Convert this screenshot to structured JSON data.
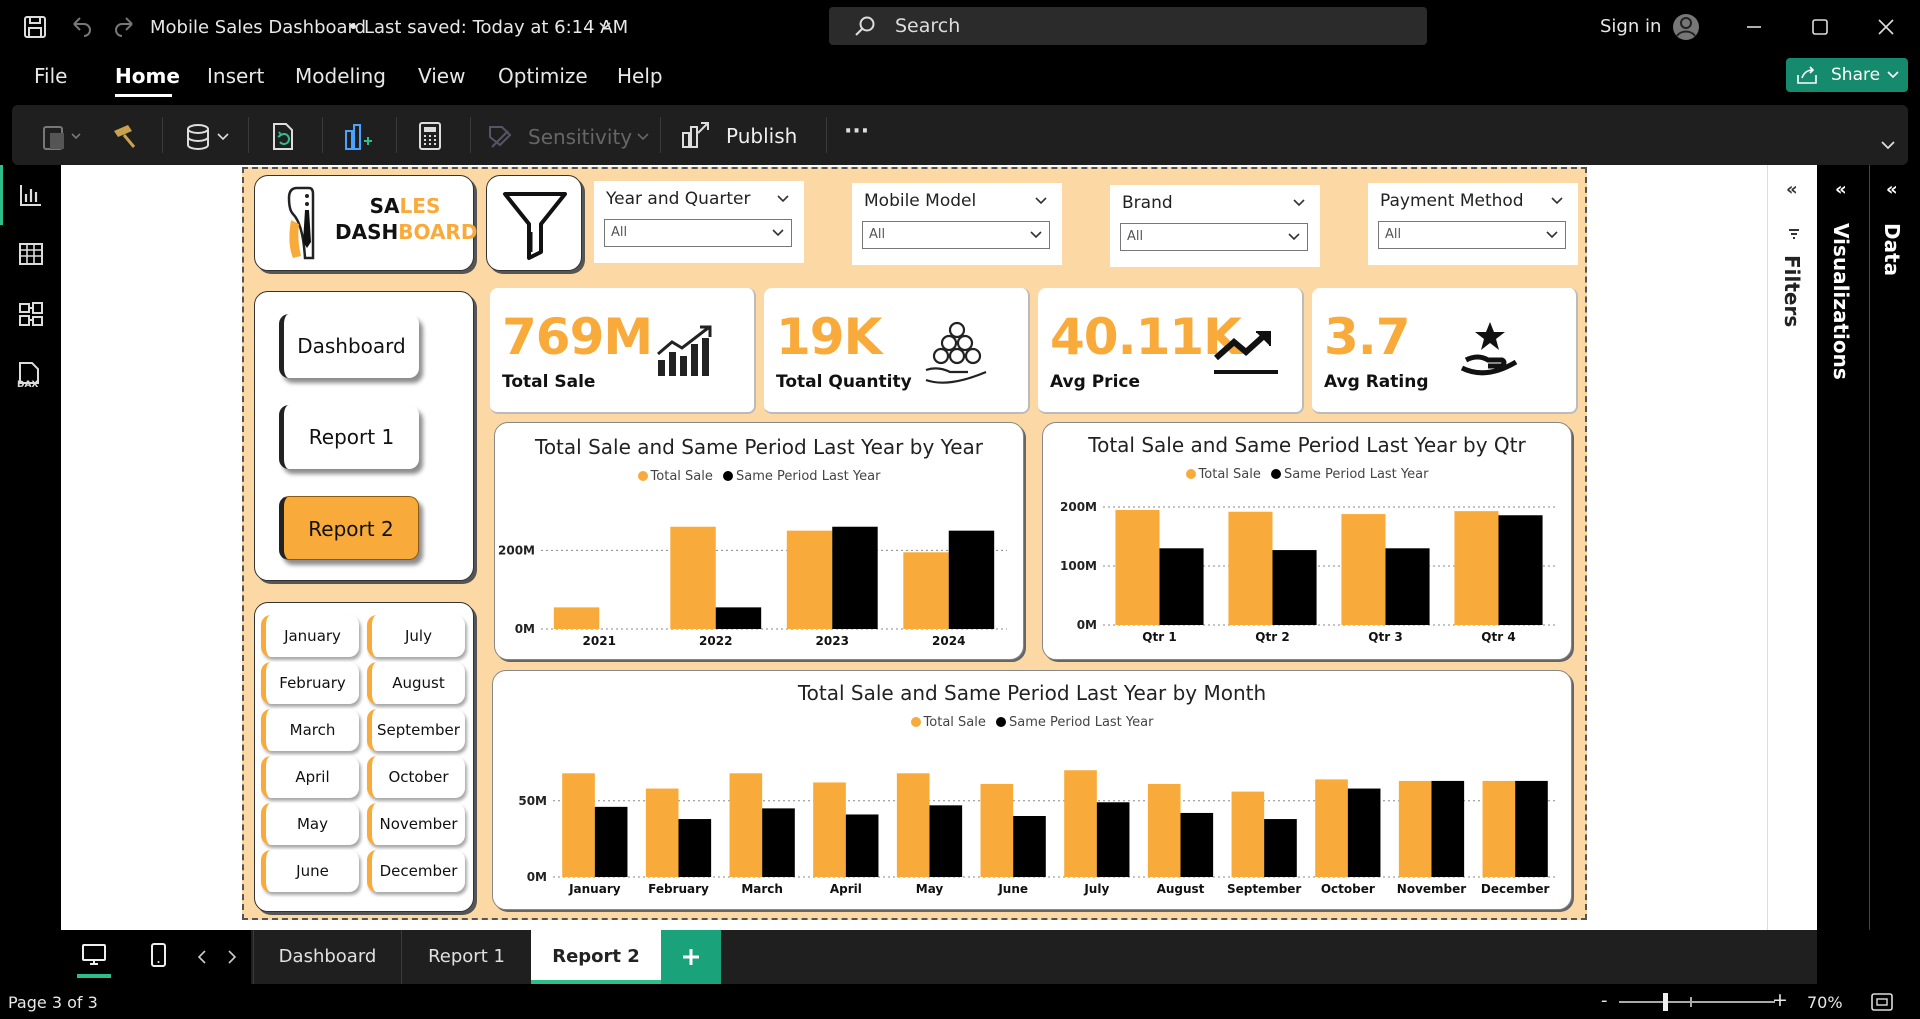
{
  "window": {
    "title": "Mobile Sales Dashboard",
    "saved_status": "Last saved: Today at 6:14 AM",
    "search_placeholder": "Search",
    "signin_label": "Sign in"
  },
  "menu": {
    "items": [
      "File",
      "Home",
      "Insert",
      "Modeling",
      "View",
      "Optimize",
      "Help"
    ],
    "active": "Home",
    "share_label": "Share"
  },
  "ribbon": {
    "sensitivity_label": "Sensitivity",
    "publish_label": "Publish",
    "more_label": "···"
  },
  "report": {
    "logo_line1_a": "SA",
    "logo_line1_b": "LES",
    "logo_line2_a": "DASH",
    "logo_line2_b": "BOARD",
    "filters": [
      {
        "label": "Year and Quarter",
        "value": "All"
      },
      {
        "label": "Mobile Model",
        "value": "All"
      },
      {
        "label": "Brand",
        "value": "All"
      },
      {
        "label": "Payment Method",
        "value": "All"
      }
    ],
    "nav_buttons": [
      "Dashboard",
      "Report 1",
      "Report 2"
    ],
    "months_left": [
      "January",
      "February",
      "March",
      "April",
      "May",
      "June"
    ],
    "months_right": [
      "July",
      "August",
      "September",
      "October",
      "November",
      "December"
    ],
    "kpis": [
      {
        "value": "769M",
        "label": "Total Sale"
      },
      {
        "value": "19K",
        "label": "Total Quantity"
      },
      {
        "value": "40.11K",
        "label": "Avg Price"
      },
      {
        "value": "3.7",
        "label": "Avg Rating"
      }
    ],
    "colors": {
      "total_sale": "#f8ab3a",
      "same_period": "#000000"
    }
  },
  "chart_data": [
    {
      "type": "bar",
      "title": "Total Sale and Same Period Last Year by Year",
      "categories": [
        "2021",
        "2022",
        "2023",
        "2024"
      ],
      "series": [
        {
          "name": "Total Sale",
          "values": [
            55,
            260,
            250,
            195
          ]
        },
        {
          "name": "Same Period Last Year",
          "values": [
            0,
            55,
            260,
            250
          ]
        }
      ],
      "yticks": [
        "0M",
        "200M"
      ],
      "ylim": [
        0,
        300
      ],
      "ytick_values": [
        0,
        200
      ]
    },
    {
      "type": "bar",
      "title": "Total Sale and Same Period Last Year by Qtr",
      "categories": [
        "Qtr 1",
        "Qtr 2",
        "Qtr 3",
        "Qtr 4"
      ],
      "series": [
        {
          "name": "Total Sale",
          "values": [
            195,
            192,
            188,
            193
          ]
        },
        {
          "name": "Same Period Last Year",
          "values": [
            130,
            127,
            130,
            186
          ]
        }
      ],
      "yticks": [
        "0M",
        "100M",
        "200M"
      ],
      "ylim": [
        0,
        200
      ],
      "ytick_values": [
        0,
        100,
        200
      ]
    },
    {
      "type": "bar",
      "title": "Total Sale and Same Period Last Year by Month",
      "categories": [
        "January",
        "February",
        "March",
        "April",
        "May",
        "June",
        "July",
        "August",
        "September",
        "October",
        "November",
        "December"
      ],
      "series": [
        {
          "name": "Total Sale",
          "values": [
            68,
            58,
            68,
            62,
            68,
            61,
            70,
            61,
            56,
            64,
            63,
            63
          ]
        },
        {
          "name": "Same Period Last Year",
          "values": [
            46,
            38,
            45,
            41,
            47,
            40,
            49,
            42,
            38,
            58,
            63,
            63
          ]
        }
      ],
      "yticks": [
        "0M",
        "50M"
      ],
      "ylim": [
        0,
        80
      ],
      "ytick_values": [
        0,
        50
      ]
    }
  ],
  "legend": {
    "total_sale": "Total Sale",
    "same_period": "Same Period Last Year"
  },
  "side_panes": {
    "filters": "Filters",
    "visualizations": "Visualizations",
    "data": "Data"
  },
  "tabs": [
    "Dashboard",
    "Report 1",
    "Report 2"
  ],
  "active_tab": "Report 2",
  "status": {
    "page": "Page 3 of 3",
    "zoom": "70%",
    "zoom_minus": "-",
    "zoom_plus": "+"
  }
}
